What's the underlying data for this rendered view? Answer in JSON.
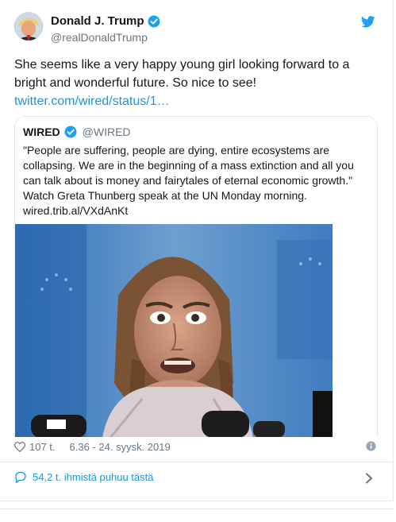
{
  "author": {
    "name": "Donald J. Trump",
    "handle": "@realDonaldTrump",
    "verified_icon": "verified-badge-icon",
    "brand_icon": "twitter-bird-icon"
  },
  "tweet": {
    "text": "She seems like a very happy young girl looking forward to a bright and wonderful future. So nice to see!",
    "link": "twitter.com/wired/status/1…"
  },
  "quoted": {
    "name": "WIRED",
    "handle": "@WIRED",
    "text": "\"People are suffering, people are dying, entire ecosystems are collapsing. We are in the beginning of a mass extinction and all you can talk about is money and fairytales of eternal economic growth.\" Watch Greta Thunberg speak at the UN Monday morning.",
    "link": "wired.trib.al/VXdAnKt"
  },
  "meta": {
    "likes": "107 t.",
    "timestamp": "6.36 - 24. syysk. 2019"
  },
  "replies": {
    "label": "54,2 t. ihmistä puhuu tästä"
  },
  "colors": {
    "accent": "#1b95e0",
    "muted": "#657786",
    "border": "#e1e8ed"
  }
}
